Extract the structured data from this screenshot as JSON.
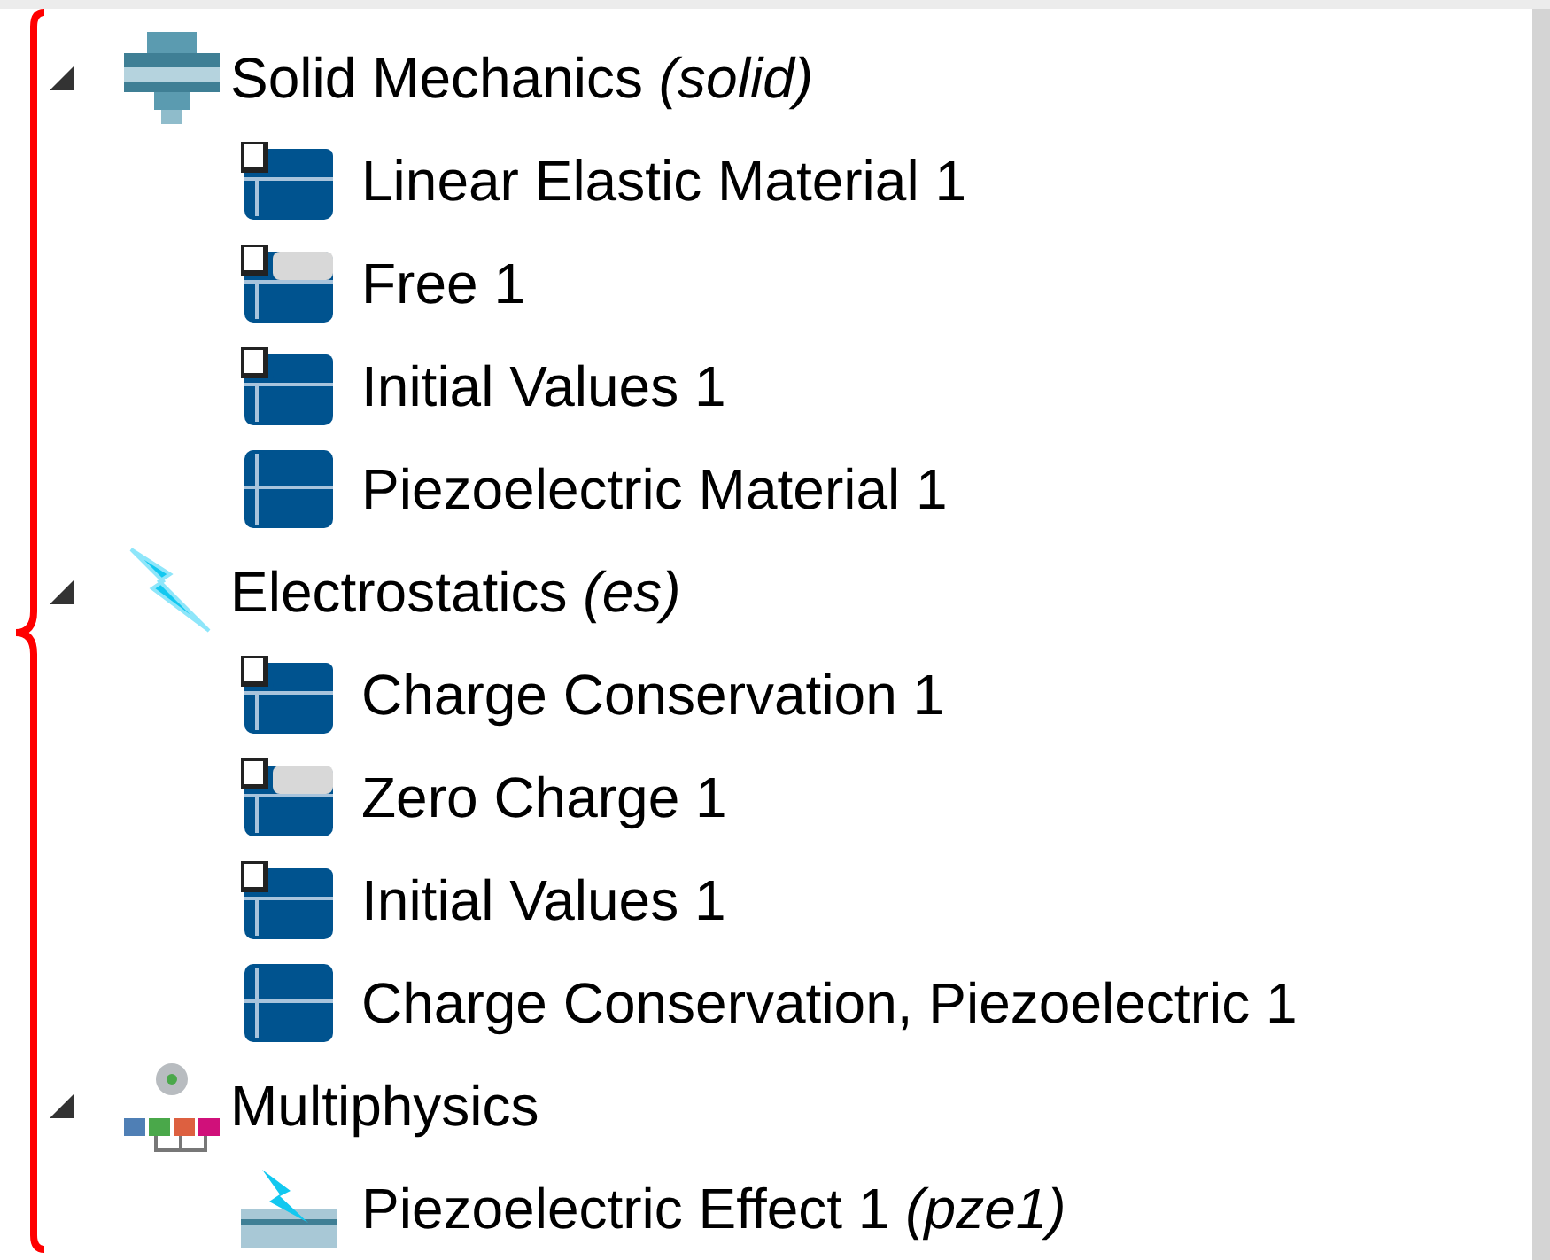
{
  "tree": [
    {
      "label": "Solid Mechanics *(solid)*",
      "kind": "solid",
      "expanded": true,
      "children": [
        {
          "label": "Linear Elastic Material 1",
          "kind": "default"
        },
        {
          "label": "Free 1",
          "kind": "default_boundary"
        },
        {
          "label": "Initial Values 1",
          "kind": "default"
        },
        {
          "label": "Piezoelectric Material 1",
          "kind": "domain"
        }
      ]
    },
    {
      "label": "Electrostatics *(es)*",
      "kind": "electrostatics",
      "expanded": true,
      "children": [
        {
          "label": "Charge Conservation 1",
          "kind": "default"
        },
        {
          "label": "Zero Charge 1",
          "kind": "default_boundary"
        },
        {
          "label": "Initial Values 1",
          "kind": "default"
        },
        {
          "label": "Charge Conservation, Piezoelectric 1",
          "kind": "domain"
        }
      ]
    },
    {
      "label": "Multiphysics",
      "kind": "multiphysics",
      "expanded": true,
      "children": [
        {
          "label": "Piezoelectric Effect 1 *(pze1)*",
          "kind": "coupling"
        }
      ]
    }
  ]
}
